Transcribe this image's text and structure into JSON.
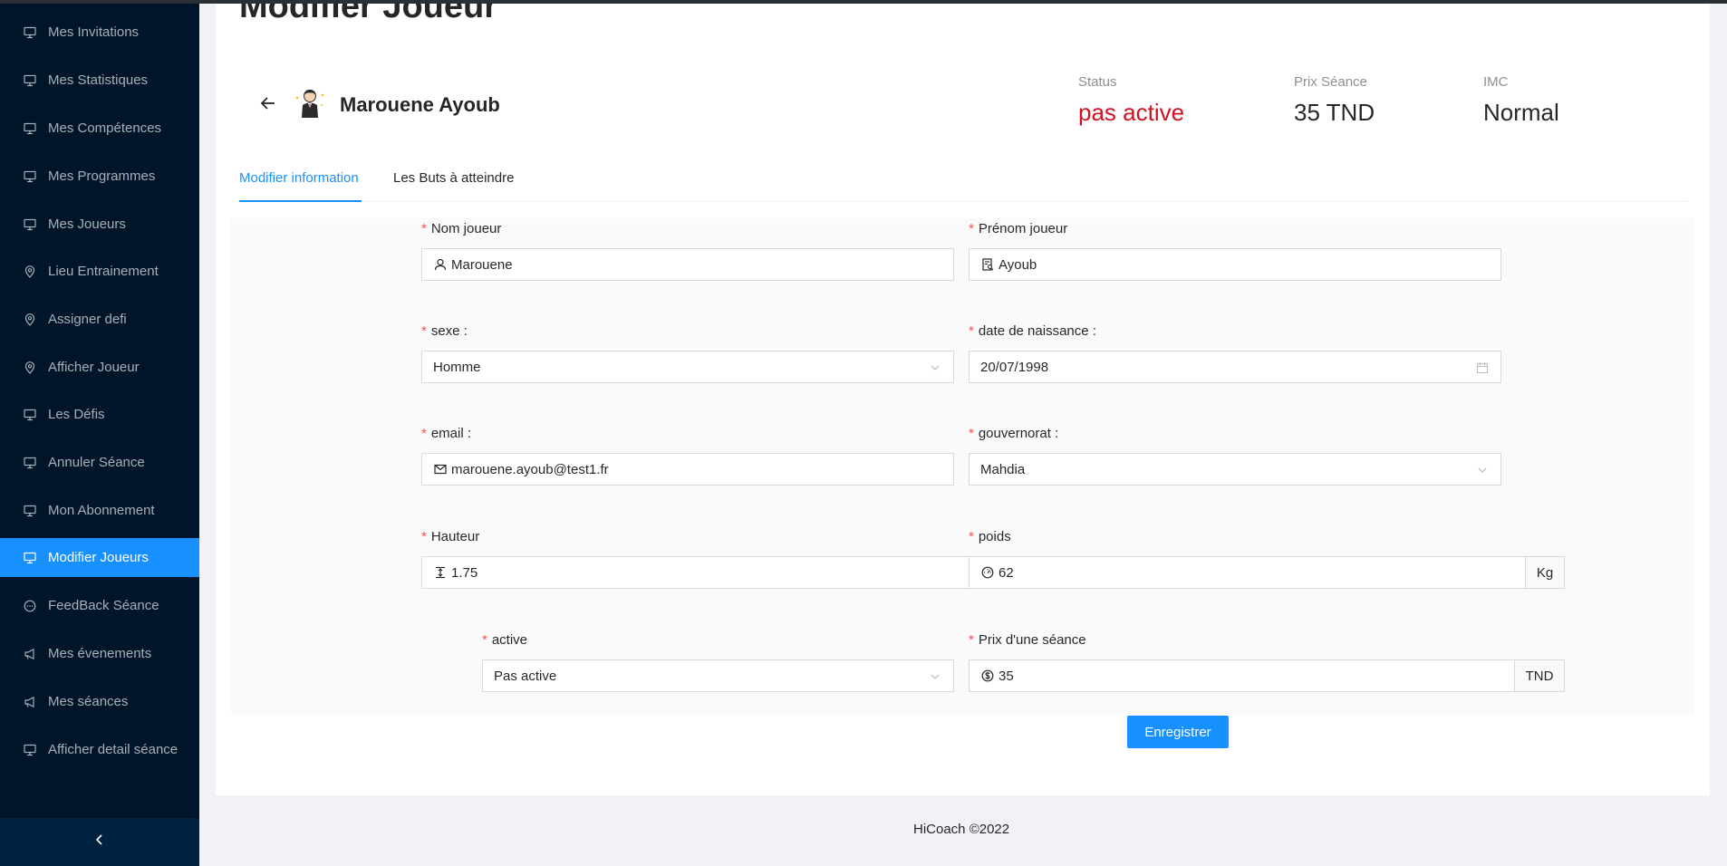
{
  "sidebar": {
    "items": [
      {
        "label": "Mes Invitations",
        "icon": "desktop-icon"
      },
      {
        "label": "Mes Statistiques",
        "icon": "desktop-icon"
      },
      {
        "label": "Mes Compétences",
        "icon": "desktop-icon"
      },
      {
        "label": "Mes Programmes",
        "icon": "desktop-icon"
      },
      {
        "label": "Mes Joueurs",
        "icon": "desktop-icon"
      },
      {
        "label": "Lieu Entrainement",
        "icon": "location-icon"
      },
      {
        "label": "Assigner defi",
        "icon": "location-icon"
      },
      {
        "label": "Afficher Joueur",
        "icon": "location-icon"
      },
      {
        "label": "Les Défis",
        "icon": "desktop-icon"
      },
      {
        "label": "Annuler Séance",
        "icon": "desktop-icon"
      },
      {
        "label": "Mon Abonnement",
        "icon": "desktop-icon"
      },
      {
        "label": "Modifier Joueurs",
        "icon": "desktop-icon",
        "active": true
      },
      {
        "label": "FeedBack Séance",
        "icon": "message-icon"
      },
      {
        "label": "Mes évenements",
        "icon": "notification-icon"
      },
      {
        "label": "Mes séances",
        "icon": "notification-icon"
      },
      {
        "label": "Afficher detail séance",
        "icon": "desktop-icon"
      }
    ],
    "collapse_icon": "chevron-left-icon"
  },
  "page": {
    "title": "Modifier Joueur"
  },
  "header": {
    "player_name": "Marouene Ayoub",
    "stats": {
      "status_label": "Status",
      "status_value": "pas active",
      "price_label": "Prix Séance",
      "price_value": "35 TND",
      "imc_label": "IMC",
      "imc_value": "Normal"
    }
  },
  "tabs": [
    {
      "label": "Modifier information",
      "active": true
    },
    {
      "label": "Les Buts à atteindre",
      "active": false
    }
  ],
  "form": {
    "nom": {
      "label": "Nom joueur",
      "value": "Marouene",
      "icon": "user-icon"
    },
    "prenom": {
      "label": "Prénom joueur",
      "value": "Ayoub",
      "icon": "profile-icon"
    },
    "sexe": {
      "label": "sexe :",
      "value": "Homme"
    },
    "naissance": {
      "label": "date de naissance :",
      "value": "20/07/1998"
    },
    "email": {
      "label": "email :",
      "value": "marouene.ayoub@test1.fr",
      "icon": "mail-icon"
    },
    "gouvernorat": {
      "label": "gouvernorat :",
      "value": "Mahdia"
    },
    "hauteur": {
      "label": "Hauteur",
      "value": "1.75",
      "icon": "column-height-icon"
    },
    "poids": {
      "label": "poids",
      "value": "62",
      "addon": "Kg",
      "icon": "dashboard-icon"
    },
    "active": {
      "label": "active",
      "value": "Pas active"
    },
    "prix": {
      "label": "Prix d'une séance",
      "value": "35",
      "addon": "TND",
      "icon": "dollar-icon"
    },
    "required_mark": "*",
    "submit_label": "Enregistrer"
  },
  "footer": {
    "text": "HiCoach ©2022"
  },
  "colors": {
    "sidebar_bg": "#001529",
    "accent": "#1890ff",
    "status_red": "#cf1322",
    "required_red": "#ff4d4f"
  }
}
